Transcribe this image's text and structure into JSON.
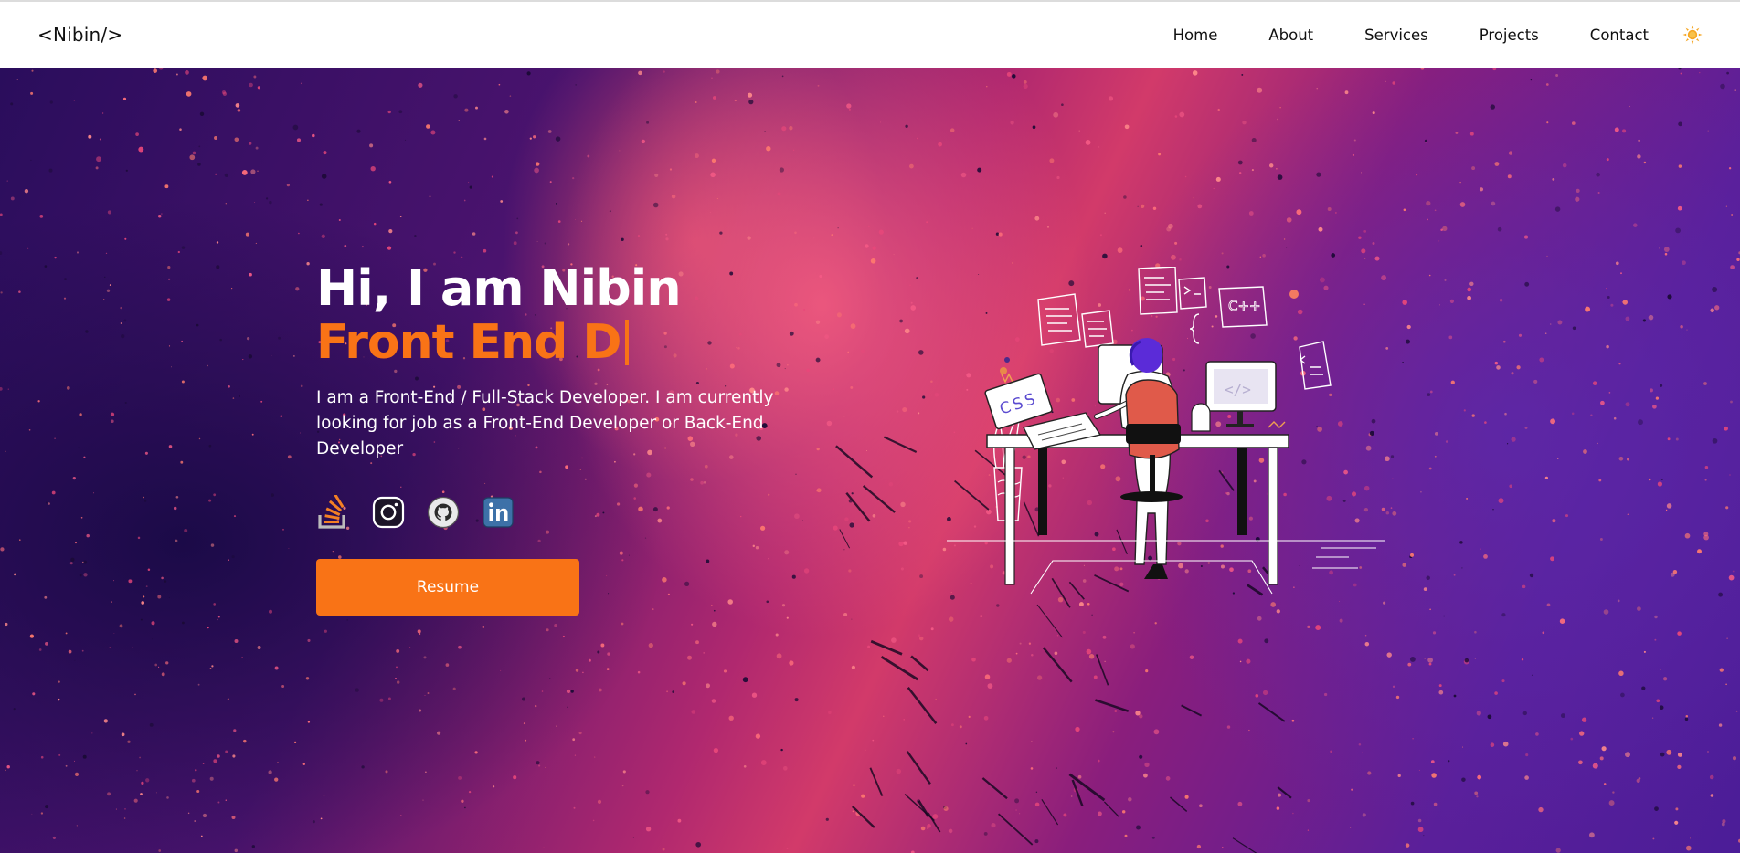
{
  "navbar": {
    "logo": "<Nibin/>",
    "links": [
      "Home",
      "About",
      "Services",
      "Projects",
      "Contact"
    ],
    "theme_icon": "sun-icon",
    "theme_color": "#f5a623"
  },
  "hero": {
    "greeting": "Hi, I am Nibin",
    "typed_role": "Front End D",
    "bio": "I am a Front-End / Full-Stack Developer. I am currently looking for job as a Front-End Developer or Back-End Developer",
    "socials": [
      {
        "name": "stackoverflow-icon"
      },
      {
        "name": "instagram-icon"
      },
      {
        "name": "github-icon"
      },
      {
        "name": "linkedin-icon"
      }
    ],
    "resume_label": "Resume",
    "illustration": {
      "laptop_text": "CSS",
      "bubble_text": "C++",
      "monitor_code": "</>"
    }
  },
  "colors": {
    "accent": "#f97316",
    "nav_bg": "#ffffff",
    "text_light": "#ffffff"
  }
}
